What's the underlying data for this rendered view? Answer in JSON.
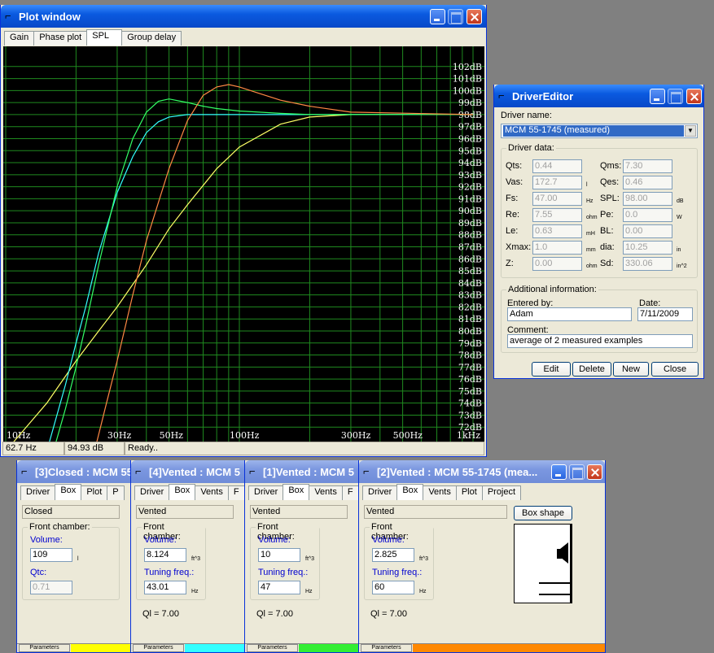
{
  "plot": {
    "title": "Plot window",
    "tabs": [
      "Gain",
      "Phase plot",
      "SPL",
      "Group delay"
    ],
    "status": [
      "62.7 Hz",
      "94.93 dB",
      "Ready.."
    ]
  },
  "chart_data": {
    "type": "line",
    "xscale": "log",
    "xlim": [
      10,
      1000
    ],
    "ylim": [
      71,
      103
    ],
    "x_ticks": [
      "10Hz",
      "30Hz",
      "50Hz",
      "100Hz",
      "300Hz",
      "500Hz",
      "1kHz"
    ],
    "y_ticks": [
      "102dB",
      "101dB",
      "100dB",
      "99dB",
      "98dB",
      "97dB",
      "96dB",
      "95dB",
      "94dB",
      "93dB",
      "92dB",
      "91dB",
      "90dB",
      "89dB",
      "88dB",
      "87dB",
      "86dB",
      "85dB",
      "84dB",
      "83dB",
      "82dB",
      "81dB",
      "80dB",
      "79dB",
      "78dB",
      "77dB",
      "76dB",
      "75dB",
      "74dB",
      "73dB",
      "72dB"
    ],
    "series": [
      {
        "color": "#ffff66",
        "x": [
          10,
          15,
          20,
          25,
          30,
          40,
          50,
          60,
          80,
          100,
          150,
          200,
          300,
          500,
          1000
        ],
        "y": [
          70,
          74,
          77.5,
          80,
          82,
          85.5,
          88.5,
          90.5,
          93.5,
          95.3,
          97.2,
          97.8,
          98.0,
          98.0,
          98.0
        ]
      },
      {
        "color": "#33ffff",
        "x": [
          15,
          18,
          20,
          22,
          25,
          30,
          35,
          40,
          45,
          50,
          60,
          80,
          100,
          200,
          500,
          1000
        ],
        "y": [
          70,
          75.5,
          79,
          82,
          86.5,
          91.5,
          94.5,
          96.5,
          97.4,
          97.8,
          98.0,
          98.0,
          98.0,
          98.0,
          98.0,
          98.0
        ]
      },
      {
        "color": "#33ff66",
        "x": [
          16,
          18,
          20,
          22,
          25,
          30,
          35,
          40,
          45,
          50,
          60,
          70,
          80,
          100,
          150,
          200,
          300,
          1000
        ],
        "y": [
          70,
          73.5,
          77,
          80.5,
          85.5,
          92,
          96,
          98.2,
          99.1,
          99.3,
          99.0,
          98.7,
          98.5,
          98.3,
          98.1,
          98.0,
          98.0,
          98.0
        ]
      },
      {
        "color": "#ff8844",
        "x": [
          24,
          27,
          30,
          35,
          40,
          50,
          60,
          70,
          80,
          90,
          100,
          120,
          150,
          200,
          300,
          1000
        ],
        "y": [
          70,
          74,
          77.5,
          83,
          87.5,
          93.5,
          97.5,
          99.6,
          100.3,
          100.5,
          100.3,
          99.8,
          99.2,
          98.7,
          98.2,
          98.0
        ]
      }
    ]
  },
  "driver": {
    "title": "DriverEditor",
    "name_label": "Driver name:",
    "name": "MCM 55-1745 (measured)",
    "data_label": "Driver data:",
    "left": [
      {
        "l": "Qts:",
        "v": "0.44",
        "u": ""
      },
      {
        "l": "Vas:",
        "v": "172.7",
        "u": "l"
      },
      {
        "l": "Fs:",
        "v": "47.00",
        "u": "Hz"
      },
      {
        "l": "Re:",
        "v": "7.55",
        "u": "ohm"
      },
      {
        "l": "Le:",
        "v": "0.63",
        "u": "mH"
      },
      {
        "l": "Xmax:",
        "v": "1.0",
        "u": "mm"
      },
      {
        "l": "Z:",
        "v": "0.00",
        "u": "ohm"
      }
    ],
    "right": [
      {
        "l": "Qms:",
        "v": "7.30",
        "u": ""
      },
      {
        "l": "Qes:",
        "v": "0.46",
        "u": ""
      },
      {
        "l": "SPL:",
        "v": "98.00",
        "u": "dB"
      },
      {
        "l": "Pe:",
        "v": "0.0",
        "u": "W"
      },
      {
        "l": "BL:",
        "v": "0.00",
        "u": ""
      },
      {
        "l": "dia:",
        "v": "10.25",
        "u": "in"
      },
      {
        "l": "Sd:",
        "v": "330.06",
        "u": "in^2"
      }
    ],
    "add_label": "Additional information:",
    "entered_label": "Entered by:",
    "entered": "Adam",
    "date_label": "Date:",
    "date": "7/11/2009",
    "comment_label": "Comment:",
    "comment": "average of 2 measured examples",
    "buttons": [
      "Edit",
      "Delete",
      "New",
      "Close"
    ]
  },
  "boxes": [
    {
      "title": "[3]Closed : MCM 55",
      "tabs": [
        "Driver",
        "Box",
        "Plot",
        "P"
      ],
      "type": "Closed",
      "chamber": "Front chamber:",
      "f1l": "Volume:",
      "f1": "109",
      "u1": "l",
      "f2l": "Qtc:",
      "f2": "0.71",
      "u2": "",
      "ql": "",
      "color": "#ffff00"
    },
    {
      "title": "[4]Vented : MCM 5",
      "tabs": [
        "Driver",
        "Box",
        "Vents",
        "F"
      ],
      "type": "Vented",
      "chamber": "Front chamber:",
      "f1l": "Volume:",
      "f1": "8.124",
      "u1": "ft^3",
      "f2l": "Tuning freq.:",
      "f2": "43.01",
      "u2": "Hz",
      "ql": "Ql = 7.00",
      "color": "#33ffff"
    },
    {
      "title": "[1]Vented : MCM 5",
      "tabs": [
        "Driver",
        "Box",
        "Vents",
        "F"
      ],
      "type": "Vented",
      "chamber": "Front chamber:",
      "f1l": "Volume:",
      "f1": "10",
      "u1": "ft^3",
      "f2l": "Tuning freq.:",
      "f2": "47",
      "u2": "Hz",
      "ql": "Ql = 7.00",
      "color": "#33ee33"
    },
    {
      "title": "[2]Vented : MCM 55-1745 (mea...",
      "tabs": [
        "Driver",
        "Box",
        "Vents",
        "Plot",
        "Project"
      ],
      "type": "Vented",
      "chamber": "Front chamber:",
      "f1l": "Volume:",
      "f1": "2.825",
      "u1": "ft^3",
      "f2l": "Tuning freq.:",
      "f2": "60",
      "u2": "Hz",
      "ql": "Ql = 7.00",
      "color": "#ff8800",
      "shape_btn": "Box shape"
    }
  ],
  "params_label": "Parameters"
}
